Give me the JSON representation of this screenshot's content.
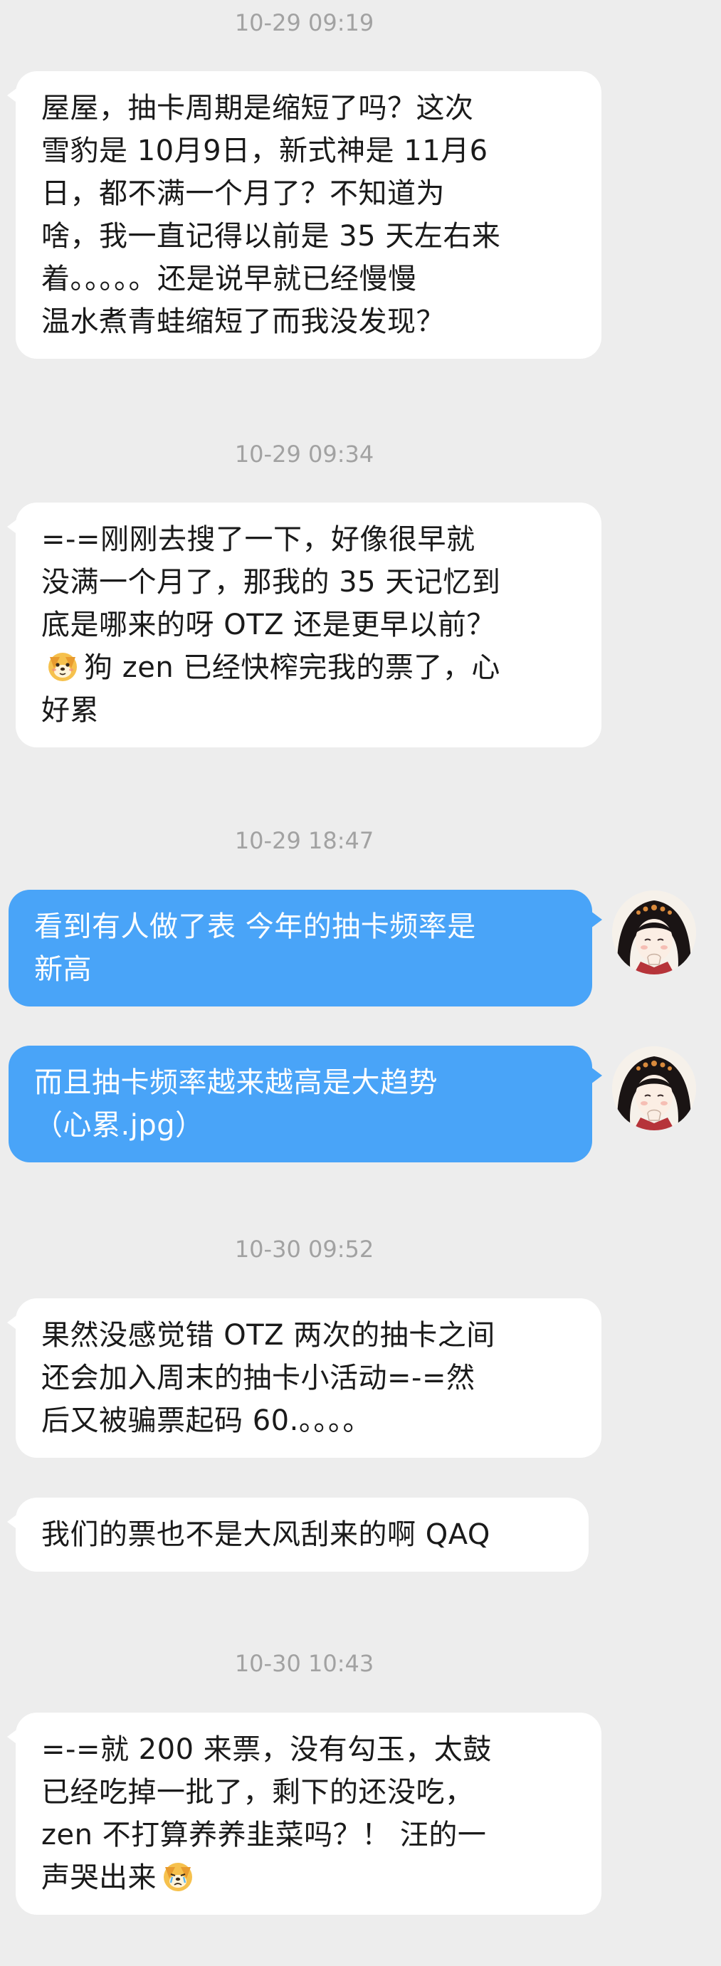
{
  "messages": {
    "m1": {
      "time": "10-29 09:19",
      "text": "屋屋，抽卡周期是缩短了吗？这次\n雪豹是 10月9日，新式神是 11月6\n日，都不满一个月了？不知道为\n啥，我一直记得以前是 35 天左右来\n着。。。。。还是说早就已经慢慢\n温水煮青蛙缩短了而我没发现？"
    },
    "m2": {
      "time": "10-29 09:34",
      "line1": "=-=刚刚去搜了一下，好像很早就\n没满一个月了，那我的 35 天记忆到\n底是哪来的呀 OTZ 还是更早以前？\n",
      "line2": "狗 zen 已经快榨完我的票了，心\n好累"
    },
    "m3": {
      "time": "10-29 18:47",
      "text": "看到有人做了表 今年的抽卡频率是\n新高"
    },
    "m4": {
      "text": "而且抽卡频率越来越高是大趋势\n（心累.jpg）"
    },
    "m5": {
      "time": "10-30 09:52",
      "text": "果然没感觉错 OTZ 两次的抽卡之间\n还会加入周末的抽卡小活动=-=然\n后又被骗票起码 60.。。。。"
    },
    "m6": {
      "text": "我们的票也不是大风刮来的啊 QAQ"
    },
    "m7": {
      "time": "10-30 10:43",
      "text": "=-=就 200 来票，没有勾玉，太鼓\n已经吃掉一批了，剩下的还没吃，\nzen 不打算养养韭菜吗？！ 汪的一\n声哭出来"
    }
  },
  "colors": {
    "background": "#ededed",
    "incoming_bubble": "#ffffff",
    "outgoing_bubble": "#49a4f8",
    "timestamp": "#a2a2a2"
  },
  "icons": {
    "emoji": "dog-face-emoji",
    "avatar": "user-avatar"
  }
}
